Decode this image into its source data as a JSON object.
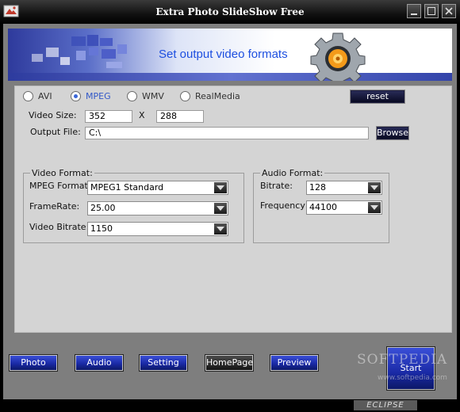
{
  "window": {
    "title": "Extra Photo SlideShow Free"
  },
  "banner": {
    "title": "Set output video formats"
  },
  "formats": [
    {
      "label": "AVI",
      "selected": false
    },
    {
      "label": "MPEG",
      "selected": true
    },
    {
      "label": "WMV",
      "selected": false
    },
    {
      "label": "RealMedia",
      "selected": false
    }
  ],
  "reset_label": "reset",
  "video_size": {
    "label": "Video Size:",
    "width": "352",
    "x": "X",
    "height": "288"
  },
  "output_file": {
    "label": "Output File:",
    "value": "C:\\",
    "browse_label": "Browse"
  },
  "video_format": {
    "title": "Video Format:",
    "mpeg_format": {
      "label": "MPEG Format",
      "value": "MPEG1 Standard"
    },
    "framerate": {
      "label": "FrameRate:",
      "value": "25.00"
    },
    "bitrate": {
      "label": "Video Bitrate:",
      "value": "1150"
    }
  },
  "audio_format": {
    "title": "Audio Format:",
    "bitrate": {
      "label": "Bitrate:",
      "value": "128"
    },
    "frequency": {
      "label": "Frequency",
      "value": "44100"
    }
  },
  "bottom_buttons": [
    "Photo",
    "Audio",
    "Setting",
    "HomePage",
    "Preview"
  ],
  "start_label": "Start",
  "watermark": {
    "text": "SOFTPEDIA",
    "url": "www.softpedia.com"
  },
  "footer_logo": "ECLIPSE",
  "colors": {
    "accent": "#1d4fe0",
    "button_blue": "#1a2aa6",
    "panel": "#d4d4d4"
  },
  "icons": [
    "app-icon",
    "minimize-icon",
    "maximize-icon",
    "close-icon",
    "gear-icon",
    "dropdown-arrow-icon"
  ]
}
